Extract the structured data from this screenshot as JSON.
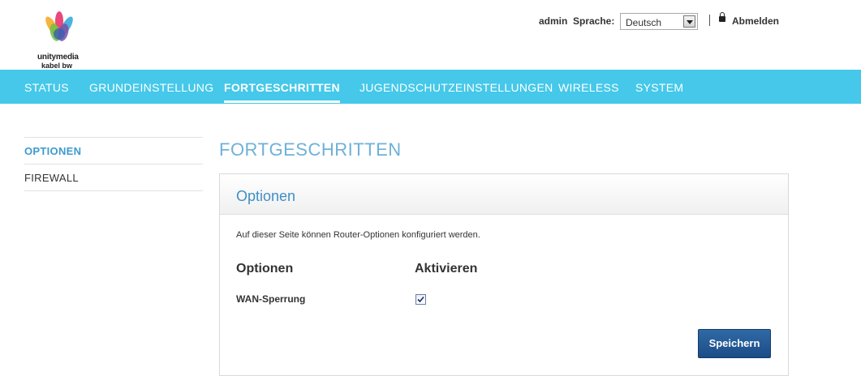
{
  "brand": {
    "line1": "unitymedia",
    "line2": "kabel bw"
  },
  "userbar": {
    "user": "admin",
    "language_label": "Sprache:",
    "language_value": "Deutsch",
    "logout_label": "Abmelden"
  },
  "nav": {
    "items": [
      {
        "label": "STATUS"
      },
      {
        "label": "GRUNDEINSTELLUNG"
      },
      {
        "label": "FORTGESCHRITTEN"
      },
      {
        "label": "JUGENDSCHUTZEINSTELLUNGEN"
      },
      {
        "label": "WIRELESS"
      },
      {
        "label": "SYSTEM"
      }
    ],
    "active": "FORTGESCHRITTEN"
  },
  "sidebar": {
    "items": [
      {
        "label": "OPTIONEN"
      },
      {
        "label": "FIREWALL"
      }
    ],
    "active": "OPTIONEN"
  },
  "main": {
    "page_title": "FORTGESCHRITTEN",
    "panel_title": "Optionen",
    "description": "Auf dieser Seite können Router-Optionen konfiguriert werden.",
    "col_options": "Optionen",
    "col_activate": "Aktivieren",
    "rows": [
      {
        "label": "WAN-Sperrung",
        "checked": true
      }
    ],
    "save_label": "Speichern"
  },
  "colors": {
    "nav_bg": "#45c8e9",
    "accent_title": "#6eb1d9",
    "panel_title": "#3f8fc5",
    "button": "#1c4c86"
  }
}
